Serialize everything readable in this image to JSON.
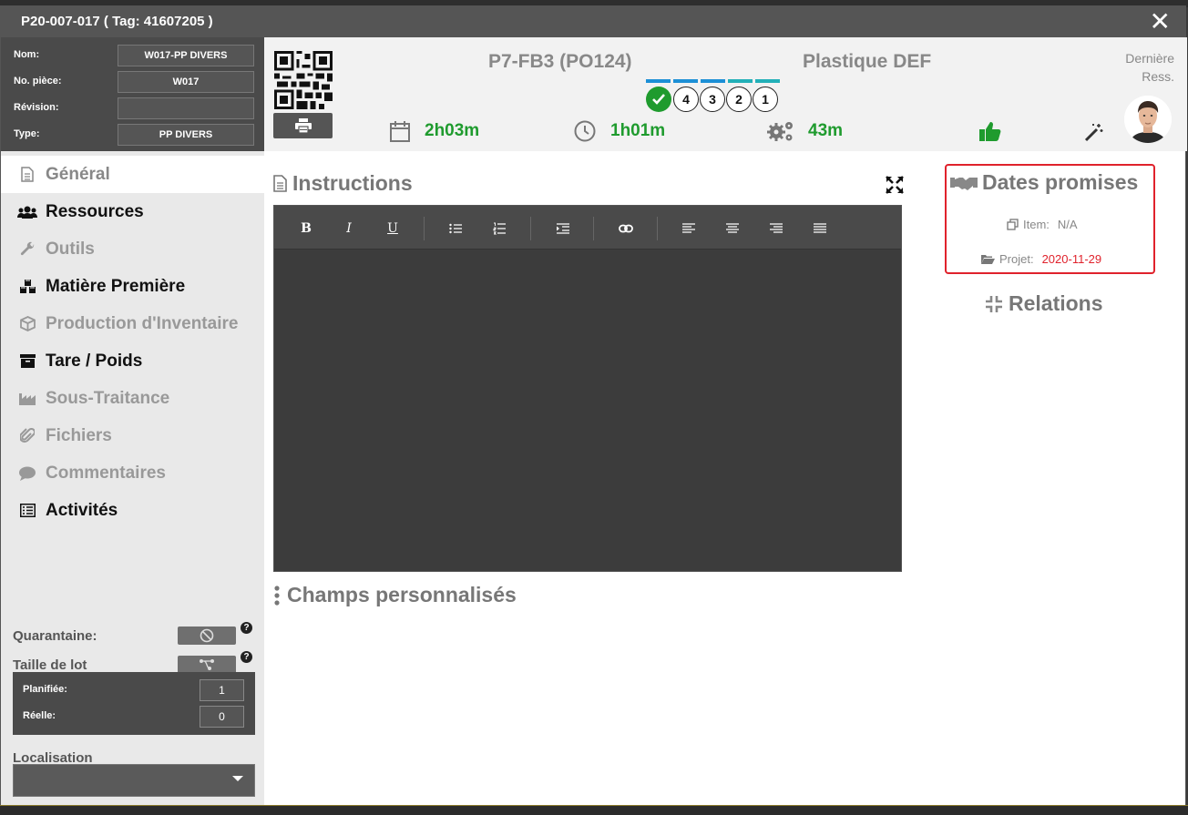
{
  "window": {
    "title": "P20-007-017 ( Tag: 41607205 )"
  },
  "info": {
    "rows": [
      {
        "label": "Nom:",
        "value": "W017-PP DIVERS"
      },
      {
        "label": "No. pièce:",
        "value": "W017"
      },
      {
        "label": "Révision:",
        "value": ""
      },
      {
        "label": "Type:",
        "value": "PP DIVERS"
      }
    ]
  },
  "nav": {
    "items": [
      {
        "label": "Général",
        "icon": "file-icon",
        "state": "active"
      },
      {
        "label": "Ressources",
        "icon": "users-icon",
        "state": "normal"
      },
      {
        "label": "Outils",
        "icon": "wrench-icon",
        "state": "muted"
      },
      {
        "label": "Matière Première",
        "icon": "cubes-icon",
        "state": "normal"
      },
      {
        "label": "Production d'Inventaire",
        "icon": "box-icon",
        "state": "muted"
      },
      {
        "label": "Tare / Poids",
        "icon": "archive-icon",
        "state": "normal"
      },
      {
        "label": "Sous-Traitance",
        "icon": "industry-icon",
        "state": "muted"
      },
      {
        "label": "Fichiers",
        "icon": "paperclip-icon",
        "state": "muted"
      },
      {
        "label": "Commentaires",
        "icon": "comment-icon",
        "state": "muted"
      },
      {
        "label": "Activités",
        "icon": "list-icon",
        "state": "normal"
      }
    ]
  },
  "bottom": {
    "quarantine_label": "Quarantaine:",
    "lot_label": "Taille de lot",
    "planned_label": "Planifiée:",
    "planned_value": "1",
    "actual_label": "Réelle:",
    "actual_value": "0",
    "location_label": "Localisation",
    "location_value": ""
  },
  "header": {
    "job_title": "P7-FB3 (PO124)",
    "customer": "Plastique DEF",
    "stages": [
      "4",
      "3",
      "2",
      "1"
    ],
    "stage_colors": [
      "#1c8fd6",
      "#1c8fd6",
      "#1c8fd6",
      "#22b0b8",
      "#22b0b8"
    ],
    "time_planned": "2h03m",
    "time_elapsed": "1h01m",
    "time_machine": "43m",
    "last_resource_label": "Dernière Ress.",
    "accent_green": "#1f9b2e"
  },
  "main": {
    "instructions_title": "Instructions",
    "custom_fields_title": "Champs personnalisés",
    "editor_content": ""
  },
  "side": {
    "dates_title": "Dates promises",
    "item_label": "Item:",
    "item_value": "N/A",
    "project_label": "Projet:",
    "project_value": "2020-11-29",
    "project_color": "#e0222c",
    "relations_title": "Relations"
  }
}
